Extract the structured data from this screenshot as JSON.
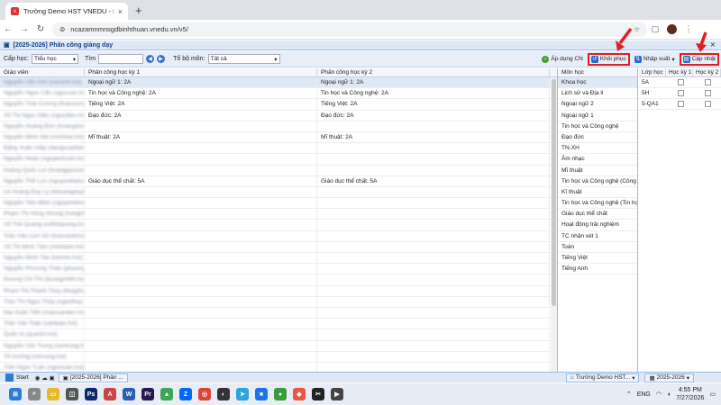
{
  "browser": {
    "tab_title": "Trường Demo HST VNEDU - Liê",
    "tab_close": "×",
    "new_tab": "+",
    "url": "ncazamnmnsgdbinhthuan.vnedu.vn/v5/",
    "icons": [
      "back-arrow-icon",
      "forward-arrow-icon",
      "reload-icon",
      "site-info-icon",
      "star-icon",
      "extensions-icon",
      "profile-avatar",
      "menu-icon"
    ]
  },
  "app": {
    "title": "[2025-2026] Phân công giảng dạy",
    "toolbar": {
      "cap_hoc_label": "Cấp học:",
      "cap_hoc_value": "Tiểu học",
      "tim_label": "Tìm",
      "tim_value": "",
      "to_bo_mon_label": "Tổ bộ môn:",
      "to_bo_mon_value": "Tất cả",
      "ap_dung_label": "Áp dụng CN",
      "khoi_phuc_label": "Khôi phục",
      "nhap_xuat_label": "Nhập xuất",
      "cap_nhat_label": "Cập nhật"
    },
    "grid": {
      "columns": [
        "Giáo viên",
        "Phân công học kỳ 1",
        "Phân công học kỳ 2"
      ],
      "rows": [
        [
          "Nguyễn Văn Anh (vananh.hst)",
          "Ngoại ngữ 1: 2A",
          "Ngoại ngữ 1: 2A"
        ],
        [
          "Nguyễn Ngọc Cẩn (ngoccan.hst)",
          "Tin học và Công nghệ: 2A",
          "Tin học và Công nghệ: 2A"
        ],
        [
          "Nguyễn Thái Cường (thaicuong.hst)",
          "Tiếng Việt: 2A",
          "Tiếng Việt: 2A"
        ],
        [
          "Võ Thị Ngọc Diệu (ngocdieu.hst)",
          "Đạo đức: 2A",
          "Đạo đức: 2A"
        ],
        [
          "Nguyễn Hoàng Đức (hoangduc.hst)",
          "",
          ""
        ],
        [
          "Nguyễn Minh Hải (minhhai.hst)",
          "Mĩ thuật: 2A",
          "Mĩ thuật: 2A"
        ],
        [
          "Đặng Xuân Hiệp (dangxuanhiep.hst)",
          "",
          ""
        ],
        [
          "Nguyễn Hoàn (nguyenhoan.hst)",
          "",
          ""
        ],
        [
          "Hoàng Quốc Lợi (hoangquocloi.hst)",
          "",
          ""
        ],
        [
          "Nguyễn Thế Lực (nguyentheluc.hst)",
          "Giáo dục thể chất: 5A",
          "Giáo dục thể chất: 5A"
        ],
        [
          "Lê Hoàng Duy Lý (lehoangduyly.hst)",
          "",
          ""
        ],
        [
          "Nguyễn Tiến Minh (nguyentienminh.hst)",
          "",
          ""
        ],
        [
          "Phạm Thị Hồng Nhung (hongnhung.hst)",
          "",
          ""
        ],
        [
          "Võ Thế Quang (vothequang.hst)",
          "",
          ""
        ],
        [
          "Trần Văn Lịch Sử (tranvanlichsu.hst)",
          "",
          ""
        ],
        [
          "Võ Thị Minh Tâm (minhtam.hst)",
          "",
          ""
        ],
        [
          "Nguyễn Minh Tân (tanmin.hst)",
          "",
          ""
        ],
        [
          "Nguyễn Phương Thảo (phuongthao.hst)",
          "",
          ""
        ],
        [
          "Dương Chí Thi (duongchithi.hst)",
          "",
          ""
        ],
        [
          "Phạm Thị Thanh Thúy (thuyphamthi.hst)",
          "",
          ""
        ],
        [
          "Trần Thị Ngọc Thủy (ngocthuy.hst)",
          "",
          ""
        ],
        [
          "Mai Xuân Tiến (maixuantien.hst)",
          "",
          ""
        ],
        [
          "Trần Văn Toàn (vantoan.hst)",
          "",
          ""
        ],
        [
          "Quản trị (quantri.hst)",
          "",
          ""
        ],
        [
          "Nguyễn Văn Trung (vantrung.hst)",
          "",
          ""
        ],
        [
          "Tổ trưởng (totruong.hst)",
          "",
          ""
        ],
        [
          "Trần Ngọc Tuấn (ngoctuan.hst)",
          "",
          ""
        ]
      ]
    },
    "subjects": {
      "header": "Môn học",
      "items": [
        "Khoa học",
        "Lịch sử và Địa lí",
        "Ngoại ngữ 2",
        "Ngoại ngữ 1",
        "Tin học và Công nghệ",
        "Đạo đức",
        "TN-XH",
        "Âm nhạc",
        "Mĩ thuật",
        "Tin học và Công nghệ (Công n...",
        "Kĩ thuật",
        "Tin học và Công nghệ (Tin học)",
        "Giáo dục thể chất",
        "Hoạt động trải nghiệm",
        "TC nhận xét 1",
        "Toán",
        "Tiếng Việt",
        "Tiếng Anh"
      ]
    },
    "classes": {
      "headers": [
        "Lớp học",
        "Học kỳ 1",
        "Học kỳ 2"
      ],
      "rows": [
        "5A",
        "5H",
        "5-QA1"
      ]
    }
  },
  "taskbar": {
    "start_label": "Start",
    "app_button": "[2025-2026] Phân ...",
    "school_button": "Trường Demo HST...",
    "year_button": "2025-2026",
    "lang": "ENG",
    "time": "4:55 PM",
    "date": "7/27/2026"
  },
  "accent": {
    "red_highlight": "#e02020",
    "header_blue": "#15428b"
  }
}
